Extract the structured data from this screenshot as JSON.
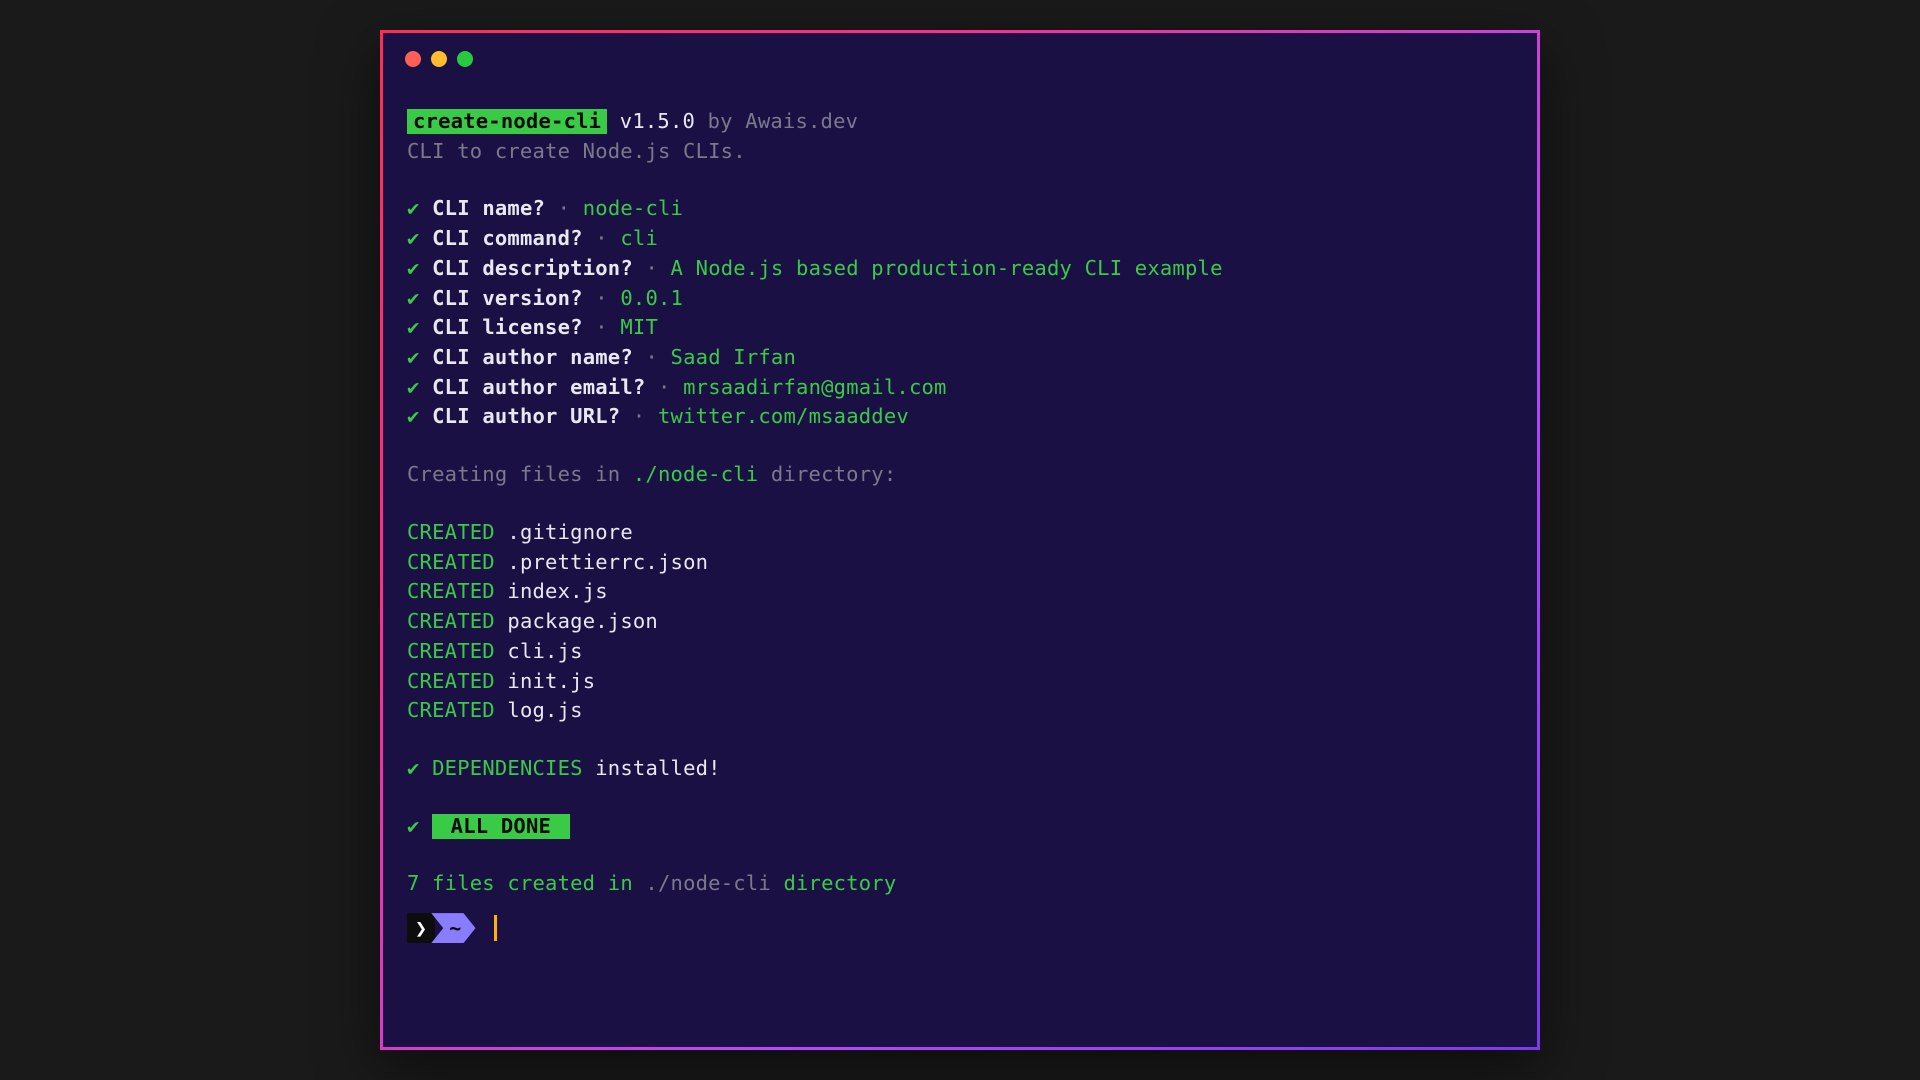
{
  "header": {
    "package_name": "create-node-cli",
    "version_prefix": " v",
    "version": "1.5.0",
    "by_text": " by Awais.dev",
    "tagline": "CLI to create Node.js CLIs."
  },
  "prompts": [
    {
      "q": "CLI name?",
      "a": "node-cli"
    },
    {
      "q": "CLI command?",
      "a": "cli"
    },
    {
      "q": "CLI description?",
      "a": "A Node.js based production-ready CLI example"
    },
    {
      "q": "CLI version?",
      "a": "0.0.1"
    },
    {
      "q": "CLI license?",
      "a": "MIT"
    },
    {
      "q": "CLI author name?",
      "a": "Saad Irfan"
    },
    {
      "q": "CLI author email?",
      "a": "mrsaadirfan@gmail.com"
    },
    {
      "q": "CLI author URL?",
      "a": "twitter.com/msaaddev"
    }
  ],
  "creating": {
    "prefix": "Creating files in ",
    "path": "./node-cli",
    "suffix": " directory:"
  },
  "created_label": "CREATED",
  "files": [
    ".gitignore",
    ".prettierrc.json",
    "index.js",
    "package.json",
    "cli.js",
    "init.js",
    "log.js"
  ],
  "deps": {
    "label": "DEPENDENCIES",
    "status": " installed!"
  },
  "all_done": " ALL DONE ",
  "summary": {
    "count": "7",
    "mid1": " files created in ",
    "path": "./node-cli",
    "suffix": " directory"
  },
  "prompt": {
    "arrow": "❯",
    "tilde": "~"
  },
  "sep": " · ",
  "check": "✔"
}
